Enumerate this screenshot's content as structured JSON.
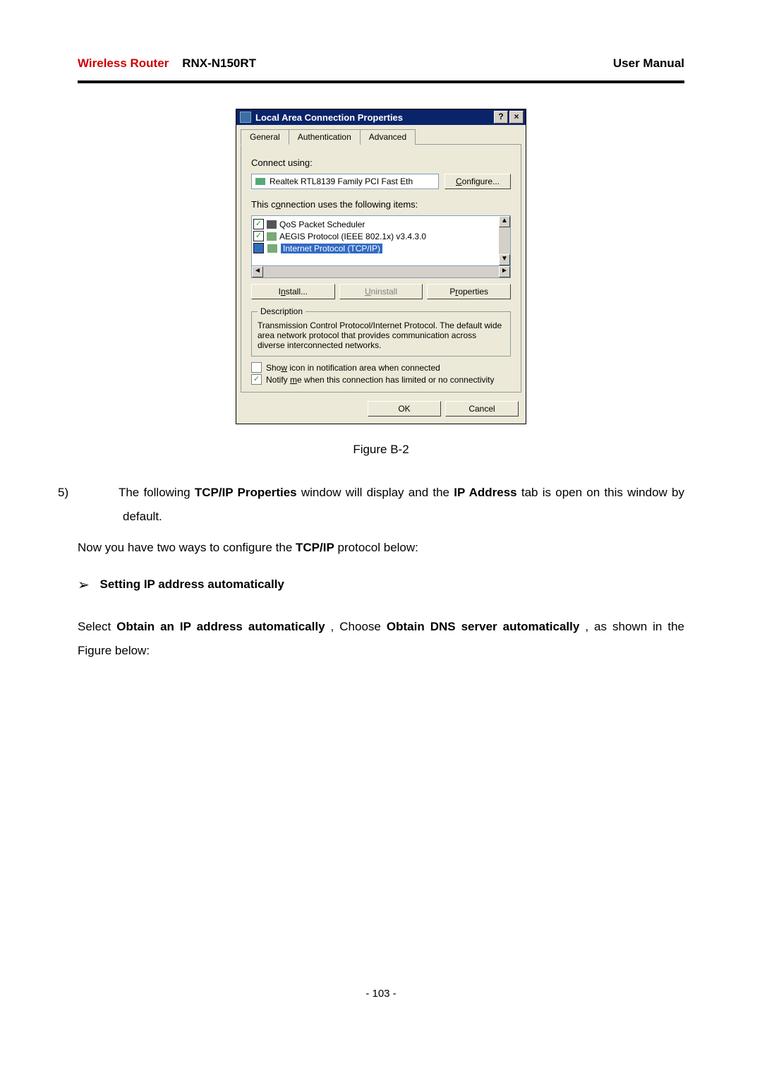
{
  "header": {
    "brand_left_red": "Wireless Router",
    "brand_left_model": "RNX-N150RT",
    "right": "User Manual"
  },
  "dialog": {
    "title": "Local Area Connection    Properties",
    "help_btn": "?",
    "close_btn": "×",
    "tabs": {
      "general": "General",
      "auth": "Authentication",
      "adv": "Advanced"
    },
    "connect_using": "Connect using:",
    "adapter": "Realtek RTL8139 Family PCI Fast Eth",
    "configure_btn": "Configure...",
    "items_label": "This connection uses the following items:",
    "item1": "QoS Packet Scheduler",
    "item2": "AEGIS Protocol (IEEE 802.1x) v3.4.3.0",
    "item3": "Internet Protocol (TCP/IP)",
    "install_btn": "Install...",
    "uninstall_btn": "Uninstall",
    "properties_btn": "Properties",
    "desc_legend": "Description",
    "desc_text": "Transmission Control Protocol/Internet Protocol. The default wide area network protocol that provides communication across diverse interconnected networks.",
    "show_icon": "Show icon in notification area when connected",
    "notify_me": "Notify me when this connection has limited or no connectivity",
    "ok": "OK",
    "cancel": "Cancel"
  },
  "figure_caption": "Figure B-2",
  "body": {
    "li5_num": "5)",
    "li5_a": "The following ",
    "li5_b_bold": "TCP/IP Properties",
    "li5_c": " window will display and the ",
    "li5_d_bold": "IP Address",
    "li5_e": " tab is open on this window by default.",
    "para2_a": "Now you have two ways to configure the ",
    "para2_b_bold": "TCP/IP",
    "para2_c": " protocol below:",
    "bullet1_bold": "Setting IP address automatically",
    "para3_a": "Select ",
    "para3_b_bold": "Obtain an IP address automatically",
    "para3_c": ", Choose ",
    "para3_d_bold": "Obtain DNS server automatically",
    "para3_e": ", as shown in the Figure below:"
  },
  "page_number": "- 103 -"
}
